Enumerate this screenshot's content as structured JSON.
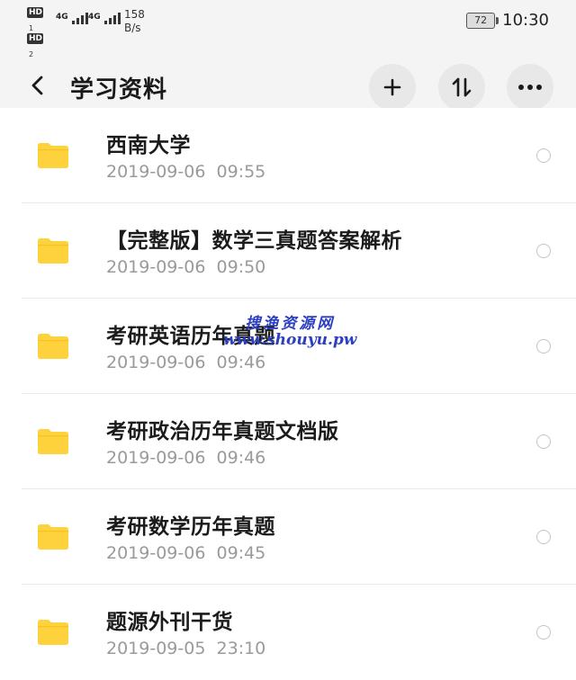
{
  "status_bar": {
    "hd1": "HD",
    "hd1_num": "1",
    "hd2": "HD",
    "hd2_num": "2",
    "signal1_label": "4G",
    "signal2_label": "4G",
    "speed_value": "158",
    "speed_unit": "B/s",
    "battery": "72",
    "time": "10:30"
  },
  "header": {
    "title": "学习资料",
    "back_icon": "chevron-left-icon",
    "add_icon": "plus-icon",
    "sort_icon": "sort-icon",
    "more_icon": "more-horizontal-icon"
  },
  "files": [
    {
      "name": "西南大学",
      "date": "2019-09-06  09:55"
    },
    {
      "name": "【完整版】数学三真题答案解析",
      "date": "2019-09-06  09:50"
    },
    {
      "name": "考研英语历年真题",
      "date": "2019-09-06  09:46"
    },
    {
      "name": "考研政治历年真题文档版",
      "date": "2019-09-06  09:46"
    },
    {
      "name": "考研数学历年真题",
      "date": "2019-09-06  09:45"
    },
    {
      "name": "题源外刊干货",
      "date": "2019-09-05  23:10"
    }
  ],
  "watermark": {
    "text": "搜渔资源网",
    "url": "www.shouyu.pw"
  },
  "colors": {
    "folder": "#fdd23c",
    "accent_dark": "#1b1b1b",
    "date_gray": "#9a9a9a",
    "watermark_blue": "#2b3fbf"
  }
}
